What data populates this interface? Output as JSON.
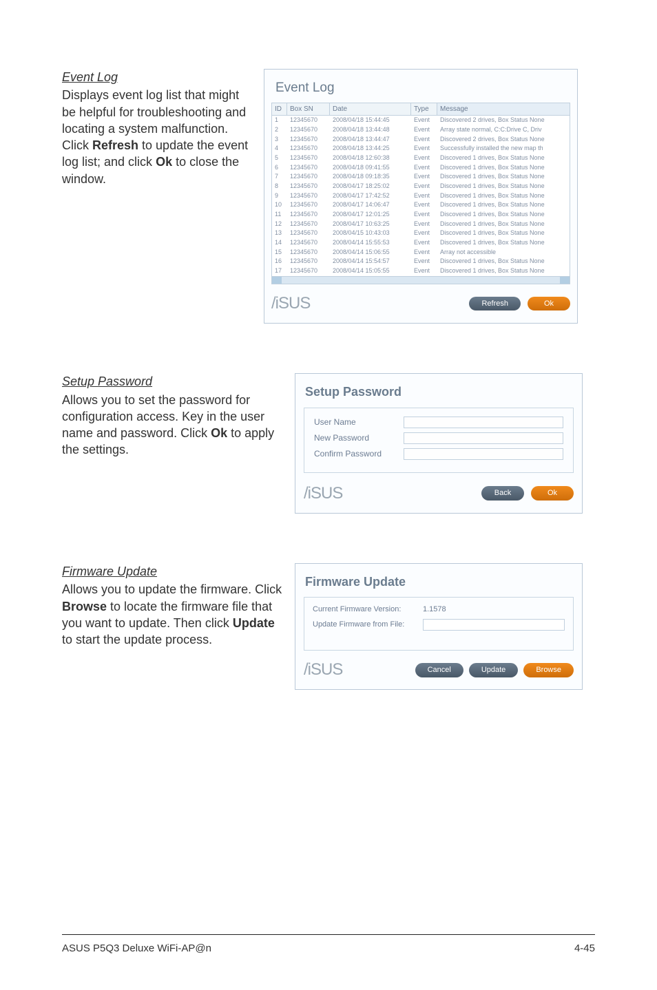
{
  "event_log": {
    "heading": "Event Log",
    "body_pre": "Displays event log list that might be helpful for troubleshooting and locating a system malfunction. Click ",
    "b1": "Refresh",
    "body_mid": " to update the event log list; and click ",
    "b2": "Ok",
    "body_post": " to close the window.",
    "dialog": {
      "title": "Event Log",
      "columns": {
        "id": "ID",
        "sn": "Box SN",
        "date": "Date",
        "type": "Type",
        "msg": "Message"
      },
      "rows": [
        {
          "id": "1",
          "sn": "12345670",
          "dt": "2008/04/18 15:44:45",
          "tp": "Event",
          "msg": "Discovered 2 drives, Box Status None"
        },
        {
          "id": "2",
          "sn": "12345670",
          "dt": "2008/04/18 13:44:48",
          "tp": "Event",
          "msg": "Array state normal, C:C:Drive C, Driv"
        },
        {
          "id": "3",
          "sn": "12345670",
          "dt": "2008/04/18 13:44:47",
          "tp": "Event",
          "msg": "Discovered 2 drives, Box Status None"
        },
        {
          "id": "4",
          "sn": "12345670",
          "dt": "2008/04/18 13:44:25",
          "tp": "Event",
          "msg": "Successfully installed the new map th"
        },
        {
          "id": "5",
          "sn": "12345670",
          "dt": "2008/04/18 12:60:38",
          "tp": "Event",
          "msg": "Discovered 1 drives, Box Status None"
        },
        {
          "id": "6",
          "sn": "12345670",
          "dt": "2008/04/18 09:41:55",
          "tp": "Event",
          "msg": "Discovered 1 drives, Box Status None"
        },
        {
          "id": "7",
          "sn": "12345670",
          "dt": "2008/04/18 09:18:35",
          "tp": "Event",
          "msg": "Discovered 1 drives, Box Status None"
        },
        {
          "id": "8",
          "sn": "12345670",
          "dt": "2008/04/17 18:25:02",
          "tp": "Event",
          "msg": "Discovered 1 drives, Box Status None"
        },
        {
          "id": "9",
          "sn": "12345670",
          "dt": "2008/04/17 17:42:52",
          "tp": "Event",
          "msg": "Discovered 1 drives, Box Status None"
        },
        {
          "id": "10",
          "sn": "12345670",
          "dt": "2008/04/17 14:06:47",
          "tp": "Event",
          "msg": "Discovered 1 drives, Box Status None"
        },
        {
          "id": "11",
          "sn": "12345670",
          "dt": "2008/04/17 12:01:25",
          "tp": "Event",
          "msg": "Discovered 1 drives, Box Status None"
        },
        {
          "id": "12",
          "sn": "12345670",
          "dt": "2008/04/17 10:63:25",
          "tp": "Event",
          "msg": "Discovered 1 drives, Box Status None"
        },
        {
          "id": "13",
          "sn": "12345670",
          "dt": "2008/04/15 10:43:03",
          "tp": "Event",
          "msg": "Discovered 1 drives, Box Status None"
        },
        {
          "id": "14",
          "sn": "12345670",
          "dt": "2008/04/14 15:55:53",
          "tp": "Event",
          "msg": "Discovered 1 drives, Box Status None"
        },
        {
          "id": "15",
          "sn": "12345670",
          "dt": "2008/04/14 15:06:55",
          "tp": "Event",
          "msg": "Array not accessible"
        },
        {
          "id": "16",
          "sn": "12345670",
          "dt": "2008/04/14 15:54:57",
          "tp": "Event",
          "msg": "Discovered 1 drives, Box Status None"
        },
        {
          "id": "17",
          "sn": "12345670",
          "dt": "2008/04/14 15:05:55",
          "tp": "Event",
          "msg": "Discovered 1 drives, Box Status None"
        }
      ],
      "refresh": "Refresh",
      "ok": "Ok"
    }
  },
  "setup_pw": {
    "heading": "Setup Password",
    "body_pre": "Allows you to set the password for configuration access. Key in the user name and password. Click ",
    "b1": "Ok",
    "body_post": " to apply the settings.",
    "dialog": {
      "title": "Setup Password",
      "user": "User Name",
      "new": "New Password",
      "confirm": "Confirm Password",
      "back": "Back",
      "ok": "Ok"
    }
  },
  "firmware": {
    "heading": "Firmware Update",
    "body_pre": "Allows you to update the firmware. Click ",
    "b1": "Browse",
    "body_mid": " to locate the firmware file that you want to update. Then click ",
    "b2": "Update",
    "body_post": " to start the update process.",
    "dialog": {
      "title": "Firmware Update",
      "cur_lbl": "Current Firmware Version:",
      "cur_val": "1.1578",
      "upd_lbl": "Update Firmware from File:",
      "cancel": "Cancel",
      "update": "Update",
      "browse": "Browse"
    }
  },
  "logo": "/iSUS",
  "footer": {
    "left": "ASUS P5Q3 Deluxe WiFi-AP@n",
    "right": "4-45"
  }
}
